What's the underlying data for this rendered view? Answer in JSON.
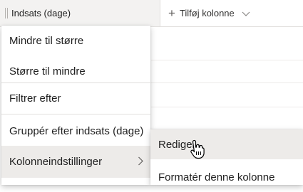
{
  "column_header": {
    "label": "Indsats (dage)"
  },
  "add_column": {
    "label": "Tilføj kolonne",
    "icon": "plus-icon",
    "dropdown_icon": "chevron-down-icon"
  },
  "menu": {
    "items": [
      {
        "label": "Mindre til større"
      },
      {
        "label": "Større til mindre"
      },
      {
        "label": "Filtrer efter"
      },
      {
        "label": "Gruppér efter indsats (dage)"
      },
      {
        "label": "Kolonneindstillinger",
        "submenu_icon": "chevron-right-icon",
        "active": true
      }
    ]
  },
  "submenu": {
    "items": [
      {
        "label": "Rediger",
        "hover": true
      },
      {
        "label": "Formatér denne kolonne"
      }
    ]
  },
  "cursor": {
    "icon": "hand-cursor-icon"
  }
}
